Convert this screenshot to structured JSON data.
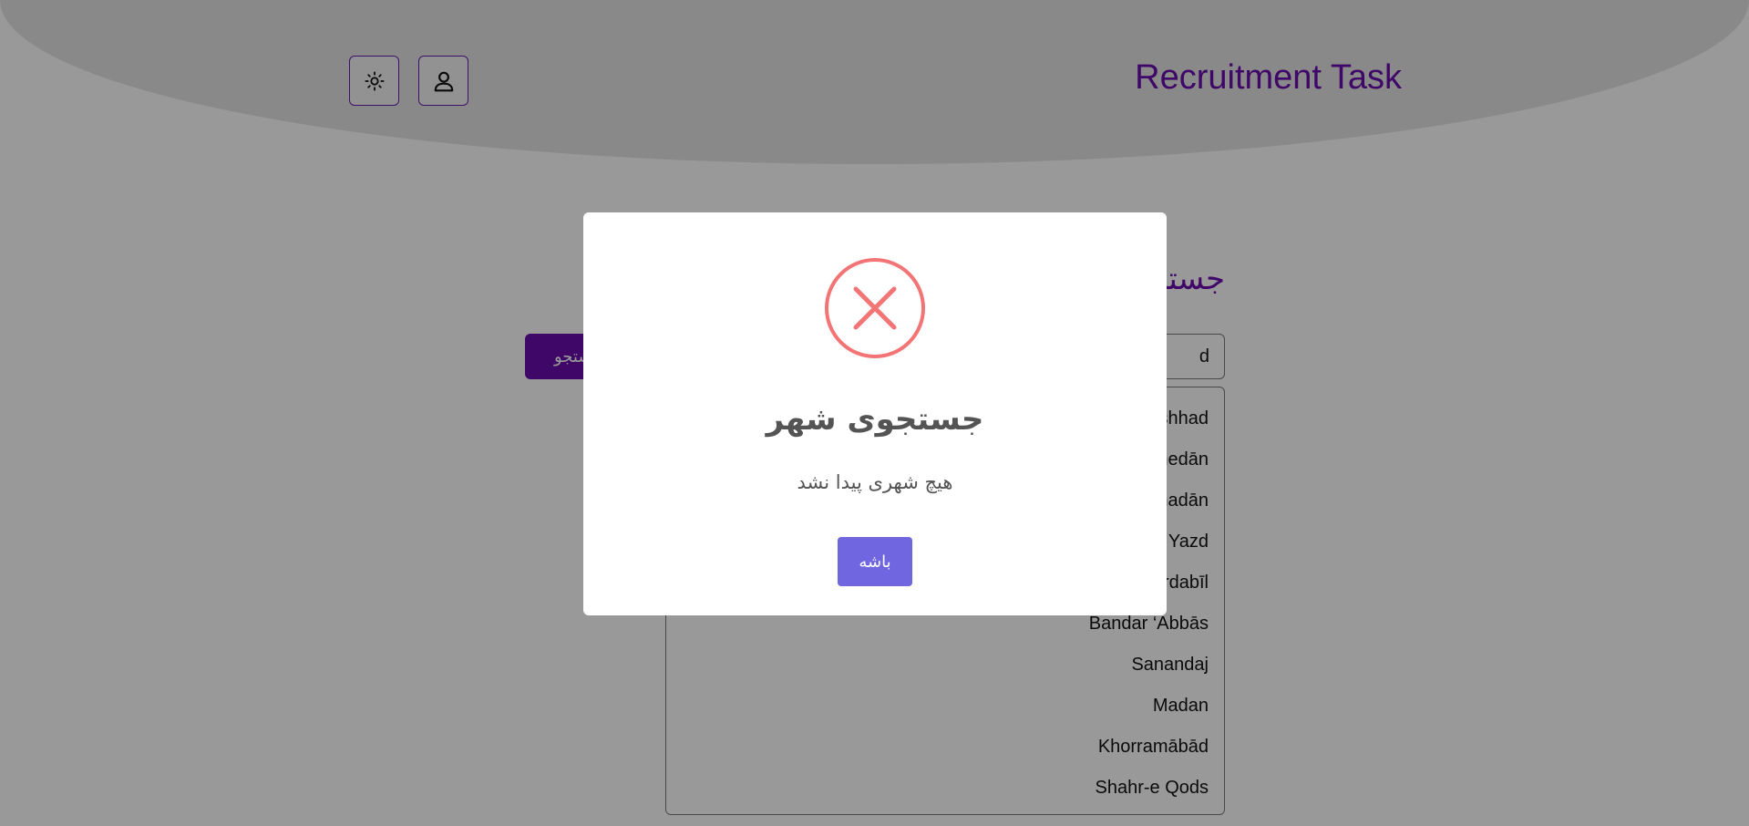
{
  "header": {
    "brand": "Recruitment Task",
    "theme_button_icon": "sun-icon",
    "profile_button_icon": "user-icon"
  },
  "search": {
    "title": "جستجوی شهر",
    "input_value": "d",
    "button_label": "جستجو"
  },
  "results": [
    "Mashhad",
    "Hamedān",
    "Hamadān",
    "Yazd",
    "Ardabīl",
    "Bandar ‘Abbās",
    "Sanandaj",
    "Madan",
    "Khorramābād",
    "Shahr-e Qods"
  ],
  "modal": {
    "icon": "error-x-icon",
    "title": "جستجوی شهر",
    "text": "هیچ شهری پیدا نشد",
    "ok_label": "باشه"
  },
  "colors": {
    "accent": "#6a0dad",
    "error": "#f27474",
    "modal_button": "#7066e0"
  }
}
